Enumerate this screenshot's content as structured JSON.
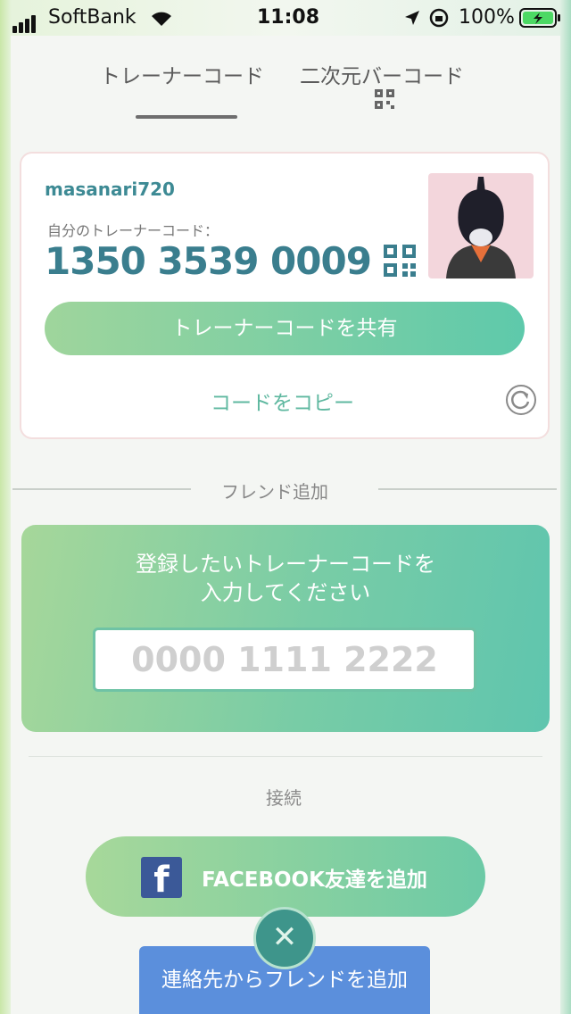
{
  "status_bar": {
    "carrier": "SoftBank",
    "time": "11:08",
    "battery": "100%"
  },
  "tabs": [
    {
      "label": "トレーナーコード",
      "active": true
    },
    {
      "label": "二次元バーコード",
      "active": false
    }
  ],
  "trainer_card": {
    "username": "masanari720",
    "code_label": "自分のトレーナーコード：",
    "code_value": "1350 3539 0009",
    "share_button": "トレーナーコードを共有",
    "copy_link": "コードをコピー"
  },
  "friend_add": {
    "section_title": "フレンド追加",
    "prompt_line1": "登録したいトレーナーコードを",
    "prompt_line2": "入力してください",
    "input_placeholder": "0000 1111 2222"
  },
  "connect": {
    "section_title": "接続",
    "facebook_button": "FACEBOOK友達を追加",
    "contacts_button": "連絡先からフレンドを追加"
  },
  "close_icon_glyph": "✕",
  "colors": {
    "accent_teal": "#3a7e8e",
    "button_green_start": "#9fd59c",
    "button_green_end": "#5ec9ab",
    "facebook_blue": "#3b5998",
    "contacts_blue": "#5b8fdc"
  }
}
